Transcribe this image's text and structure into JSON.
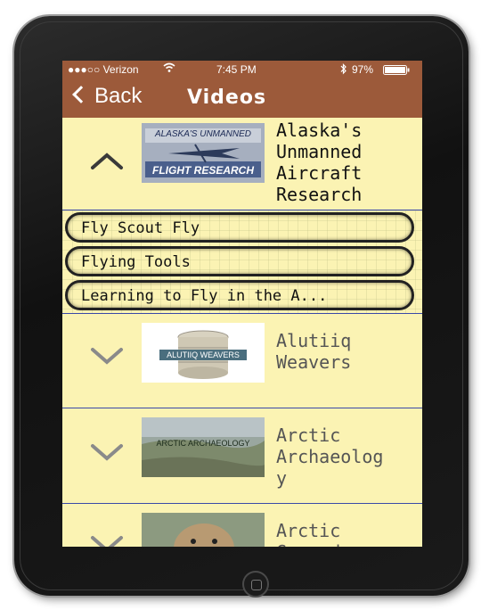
{
  "status": {
    "carrier": "●●●○○ Verizon",
    "time": "7:45 PM",
    "battery": "97%"
  },
  "nav": {
    "back_label": "Back",
    "title": "Videos"
  },
  "videos": [
    {
      "title": "Alaska's\nUnmanned\nAircraft\nResearch",
      "thumb_top": "ALASKA'S UNMANNED",
      "thumb_bottom": "FLIGHT RESEARCH",
      "expanded": true
    },
    {
      "title": "Alutiiq\nWeavers",
      "thumb_label": "ALUTIIQ WEAVERS",
      "expanded": false
    },
    {
      "title": "Arctic\nArchaeolog\ny",
      "thumb_label": "ARCTIC ARCHAEOLOGY",
      "expanded": false
    },
    {
      "title": "Arctic\nGround",
      "expanded": false
    }
  ],
  "subitems": [
    "Fly Scout Fly",
    "Flying Tools",
    "Learning to Fly in the A..."
  ],
  "colors": {
    "header": "#9c5a3a",
    "row_bg": "#fbf3b3",
    "divider": "#3a49a8"
  }
}
